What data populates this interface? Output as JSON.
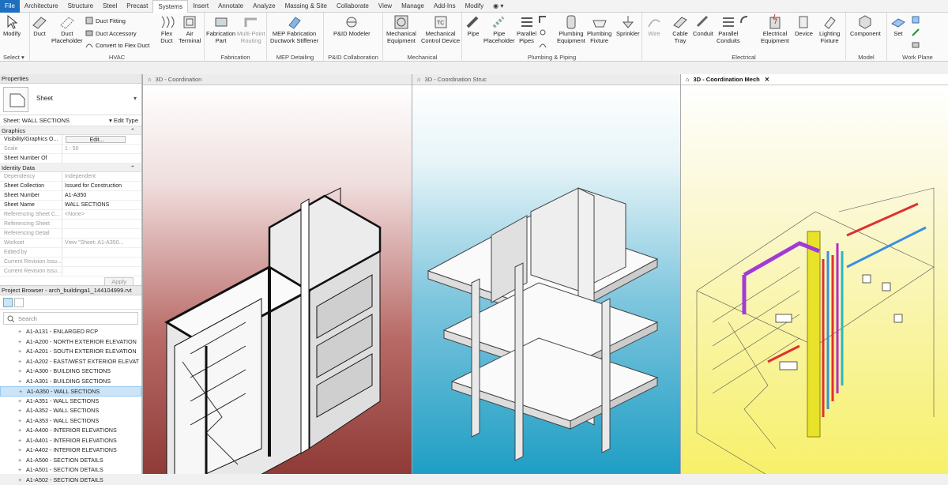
{
  "tabs": [
    "File",
    "Architecture",
    "Structure",
    "Steel",
    "Precast",
    "Systems",
    "Insert",
    "Annotate",
    "Analyze",
    "Massing & Site",
    "Collaborate",
    "View",
    "Manage",
    "Add-Ins",
    "Modify"
  ],
  "active_tab": "Systems",
  "ribbon": {
    "modify": {
      "label": "Modify",
      "group": "Select"
    },
    "hvac": {
      "duct": "Duct",
      "duct_placeholder_1": "Duct",
      "duct_placeholder_2": "Placeholder",
      "duct_fitting": "Duct  Fitting",
      "duct_accessory": "Duct  Accessory",
      "convert": "Convert to Flex Duct",
      "flex_duct_1": "Flex",
      "flex_duct_2": "Duct",
      "air_terminal_1": "Air",
      "air_terminal_2": "Terminal",
      "group": "HVAC"
    },
    "fabrication": {
      "part_1": "Fabrication",
      "part_2": "Part",
      "multi_1": "Multi-Point",
      "multi_2": "Routing",
      "group": "Fabrication"
    },
    "mep_detailing": {
      "btn_1": "MEP Fabrication",
      "btn_2": "Ductwork Stiffener",
      "group": "MEP Detailing"
    },
    "pid": {
      "btn": "P&ID Modeler",
      "group": "P&ID Collaboration"
    },
    "mechanical": {
      "equip_1": "Mechanical",
      "equip_2": "Equipment",
      "control_1": "Mechanical",
      "control_2": "Control Device",
      "group": "Mechanical"
    },
    "plumbing": {
      "pipe": "Pipe",
      "pipe_ph_1": "Pipe",
      "pipe_ph_2": "Placeholder",
      "parallel_1": "Parallel",
      "parallel_2": "Pipes",
      "equip_1": "Plumbing",
      "equip_2": "Equipment",
      "fixture_1": "Plumbing",
      "fixture_2": "Fixture",
      "sprinkler": "Sprinkler",
      "group": "Plumbing & Piping"
    },
    "electrical": {
      "wire": "Wire",
      "cable_1": "Cable",
      "cable_2": "Tray",
      "conduit": "Conduit",
      "parallel_1": "Parallel",
      "parallel_2": "Conduits",
      "equip_1": "Electrical",
      "equip_2": "Equipment",
      "device": "Device",
      "lighting_1": "Lighting",
      "lighting_2": "Fixture",
      "group": "Electrical"
    },
    "model": {
      "component": "Component",
      "group": "Model"
    },
    "workplane": {
      "set": "Set",
      "group": "Work Plane"
    }
  },
  "properties": {
    "title": "Properties",
    "type_name": "Sheet",
    "selector": "Sheet: WALL SECTIONS",
    "edit_type": "Edit Type",
    "cat_graphics": "Graphics",
    "cat_identity": "Identity Data",
    "rows_graphics": [
      {
        "k": "Visibility/Graphics O...",
        "v": "Edit...",
        "dim": false
      },
      {
        "k": "Scale",
        "v": "1 : 50",
        "dim": true
      },
      {
        "k": "Sheet Number Of",
        "v": "",
        "dim": false
      }
    ],
    "rows_identity": [
      {
        "k": "Dependency",
        "v": "Independent",
        "dim": true
      },
      {
        "k": "Sheet Collection",
        "v": "Issued for Construction",
        "dim": false
      },
      {
        "k": "Sheet Number",
        "v": "A1-A350",
        "dim": false
      },
      {
        "k": "Sheet Name",
        "v": "WALL SECTIONS",
        "dim": false
      },
      {
        "k": "Referencing Sheet C...",
        "v": "<None>",
        "dim": true
      },
      {
        "k": "Referencing Sheet",
        "v": "",
        "dim": true
      },
      {
        "k": "Referencing Detail",
        "v": "",
        "dim": true
      },
      {
        "k": "Workset",
        "v": "View \"Sheet: A1-A350...",
        "dim": true
      },
      {
        "k": "Edited by",
        "v": "",
        "dim": true
      },
      {
        "k": "Current Revision Issu...",
        "v": "",
        "dim": true
      },
      {
        "k": "Current Revision Issu...",
        "v": "",
        "dim": true
      }
    ],
    "apply": "Apply"
  },
  "browser": {
    "title": "Project Browser - arch_buildinga1_144104999.rvt",
    "search_placeholder": "Search",
    "items": [
      "A1-A131 - ENLARGED RCP",
      "A1-A200 - NORTH EXTERIOR ELEVATION",
      "A1-A201 - SOUTH EXTERIOR ELEVATION",
      "A1-A202 - EAST/WEST EXTERIOR ELEVAT",
      "A1-A300 - BUILDING SECTIONS",
      "A1-A301 - BUILDING SECTIONS",
      "A1-A350 - WALL SECTIONS",
      "A1-A351 - WALL SECTIONS",
      "A1-A352 - WALL SECTIONS",
      "A1-A353 - WALL SECTIONS",
      "A1-A400 - INTERIOR ELEVATIONS",
      "A1-A401 - INTERIOR ELEVATIONS",
      "A1-A402 - INTERIOR ELEVATIONS",
      "A1-A500 - SECTION DETAILS",
      "A1-A501 - SECTION DETAILS",
      "A1-A502 - SECTION DETAILS"
    ],
    "selected_index": 6
  },
  "views": [
    {
      "title": "3D - Coordination",
      "active": false
    },
    {
      "title": "3D - Coordination Struc",
      "active": false
    },
    {
      "title": "3D - Coordination Mech",
      "active": true
    }
  ],
  "colors": {
    "file_tab": "#1f6fbf",
    "selection": "#cce4f7",
    "mech_bg": "#f7f06a",
    "struct_bg": "#1f9ec4",
    "arch_bg": "#8f3b38"
  }
}
